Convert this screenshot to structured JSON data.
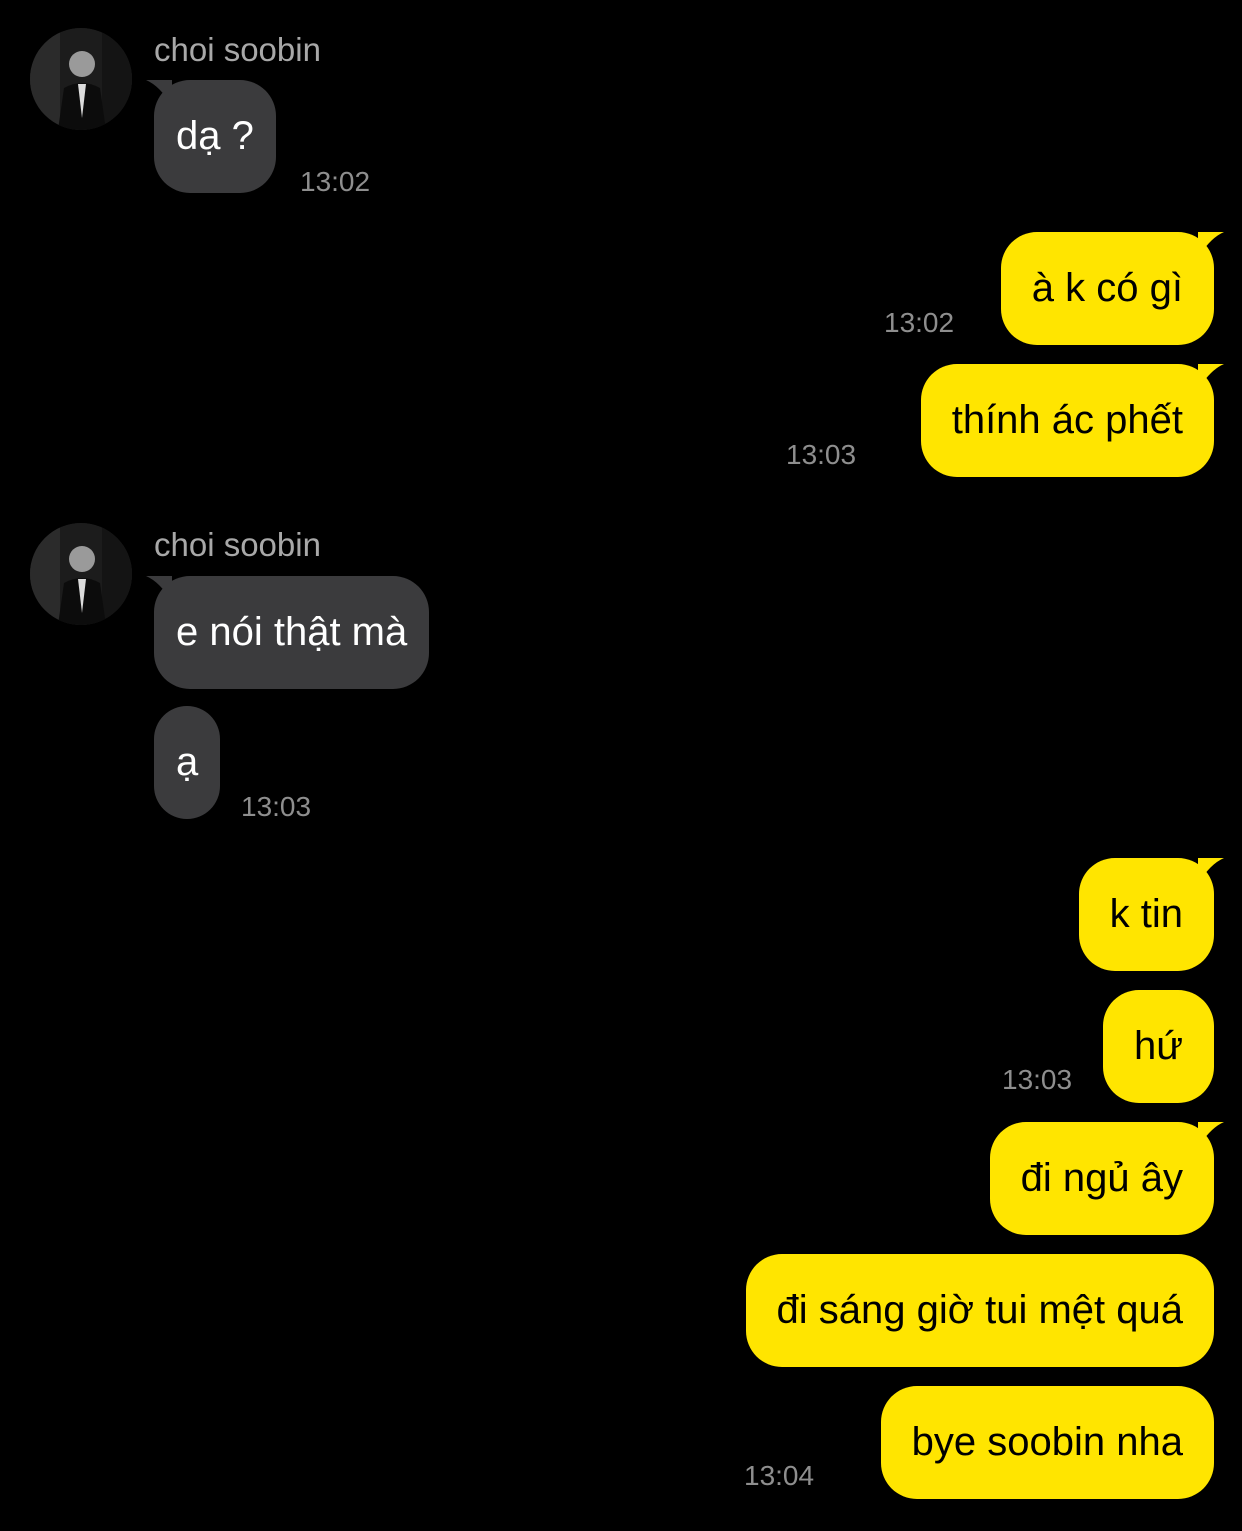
{
  "theme": {
    "background": "#000000",
    "incoming_bubble": "#3b3b3d",
    "outgoing_bubble": "#ffe500",
    "timestamp_color": "#8e8e8e",
    "sender_color": "#a8a8a8"
  },
  "conversation": {
    "sender_name": "choi soobin",
    "messages": [
      {
        "direction": "in",
        "text": "dạ ?",
        "time": "13:02"
      },
      {
        "direction": "out",
        "text": "à k có gì",
        "time": "13:02"
      },
      {
        "direction": "out",
        "text": "thính ác phết",
        "time": "13:03"
      },
      {
        "direction": "in",
        "text": "e nói thật mà"
      },
      {
        "direction": "in",
        "text": "ạ",
        "time": "13:03"
      },
      {
        "direction": "out",
        "text": "k tin"
      },
      {
        "direction": "out",
        "text": "hứ",
        "time": "13:03"
      },
      {
        "direction": "out",
        "text": "đi ngủ ây"
      },
      {
        "direction": "out",
        "text": "đi sáng giờ tui mệt quá"
      },
      {
        "direction": "out",
        "text": "bye soobin nha",
        "time": "13:04"
      }
    ]
  }
}
